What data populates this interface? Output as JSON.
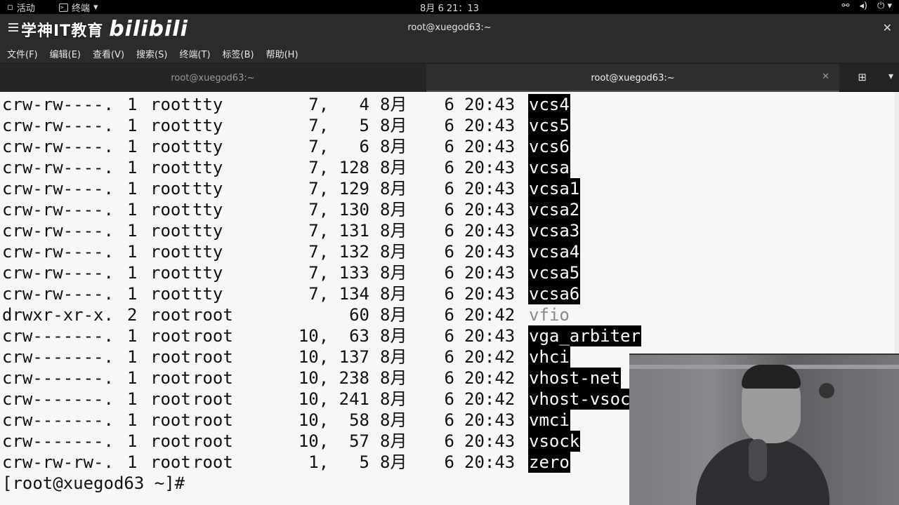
{
  "topbar": {
    "activities": "活动",
    "app_name": "终端",
    "clock": "8月 6  21：13",
    "tray_icons": [
      "network-icon",
      "volume-icon",
      "power-icon"
    ]
  },
  "window": {
    "title": "root@xuegod63:~",
    "logo_text": "学神IT教育",
    "logo_bili": "bilibili"
  },
  "menu": [
    "文件(F)",
    "编辑(E)",
    "查看(V)",
    "搜索(S)",
    "终端(T)",
    "标签(B)",
    "帮助(H)"
  ],
  "tabs": [
    {
      "label": "root@xuegod63:~",
      "active": false
    },
    {
      "label": "root@xuegod63:~",
      "active": true
    }
  ],
  "terminal": {
    "lines": [
      {
        "perm": "crw-rw----.",
        "links": "1",
        "owner": "root",
        "group": "tty",
        "size": "7,   4",
        "month": "8月",
        "day": "6",
        "time": "20:43",
        "name": "vcs4",
        "type": "dev"
      },
      {
        "perm": "crw-rw----.",
        "links": "1",
        "owner": "root",
        "group": "tty",
        "size": "7,   5",
        "month": "8月",
        "day": "6",
        "time": "20:43",
        "name": "vcs5",
        "type": "dev"
      },
      {
        "perm": "crw-rw----.",
        "links": "1",
        "owner": "root",
        "group": "tty",
        "size": "7,   6",
        "month": "8月",
        "day": "6",
        "time": "20:43",
        "name": "vcs6",
        "type": "dev"
      },
      {
        "perm": "crw-rw----.",
        "links": "1",
        "owner": "root",
        "group": "tty",
        "size": "7, 128",
        "month": "8月",
        "day": "6",
        "time": "20:43",
        "name": "vcsa",
        "type": "dev"
      },
      {
        "perm": "crw-rw----.",
        "links": "1",
        "owner": "root",
        "group": "tty",
        "size": "7, 129",
        "month": "8月",
        "day": "6",
        "time": "20:43",
        "name": "vcsa1",
        "type": "dev"
      },
      {
        "perm": "crw-rw----.",
        "links": "1",
        "owner": "root",
        "group": "tty",
        "size": "7, 130",
        "month": "8月",
        "day": "6",
        "time": "20:43",
        "name": "vcsa2",
        "type": "dev"
      },
      {
        "perm": "crw-rw----.",
        "links": "1",
        "owner": "root",
        "group": "tty",
        "size": "7, 131",
        "month": "8月",
        "day": "6",
        "time": "20:43",
        "name": "vcsa3",
        "type": "dev"
      },
      {
        "perm": "crw-rw----.",
        "links": "1",
        "owner": "root",
        "group": "tty",
        "size": "7, 132",
        "month": "8月",
        "day": "6",
        "time": "20:43",
        "name": "vcsa4",
        "type": "dev"
      },
      {
        "perm": "crw-rw----.",
        "links": "1",
        "owner": "root",
        "group": "tty",
        "size": "7, 133",
        "month": "8月",
        "day": "6",
        "time": "20:43",
        "name": "vcsa5",
        "type": "dev"
      },
      {
        "perm": "crw-rw----.",
        "links": "1",
        "owner": "root",
        "group": "tty",
        "size": "7, 134",
        "month": "8月",
        "day": "6",
        "time": "20:43",
        "name": "vcsa6",
        "type": "dev"
      },
      {
        "perm": "drwxr-xr-x.",
        "links": "2",
        "owner": "root",
        "group": "root",
        "size": "60",
        "month": "8月",
        "day": "6",
        "time": "20:42",
        "name": "vfio",
        "type": "dir"
      },
      {
        "perm": "crw-------.",
        "links": "1",
        "owner": "root",
        "group": "root",
        "size": "10,  63",
        "month": "8月",
        "day": "6",
        "time": "20:43",
        "name": "vga_arbiter",
        "type": "dev"
      },
      {
        "perm": "crw-------.",
        "links": "1",
        "owner": "root",
        "group": "root",
        "size": "10, 137",
        "month": "8月",
        "day": "6",
        "time": "20:42",
        "name": "vhci",
        "type": "dev"
      },
      {
        "perm": "crw-------.",
        "links": "1",
        "owner": "root",
        "group": "root",
        "size": "10, 238",
        "month": "8月",
        "day": "6",
        "time": "20:42",
        "name": "vhost-net",
        "type": "dev"
      },
      {
        "perm": "crw-------.",
        "links": "1",
        "owner": "root",
        "group": "root",
        "size": "10, 241",
        "month": "8月",
        "day": "6",
        "time": "20:42",
        "name": "vhost-vsoc",
        "type": "dev"
      },
      {
        "perm": "crw-------.",
        "links": "1",
        "owner": "root",
        "group": "root",
        "size": "10,  58",
        "month": "8月",
        "day": "6",
        "time": "20:43",
        "name": "vmci",
        "type": "dev"
      },
      {
        "perm": "crw-------.",
        "links": "1",
        "owner": "root",
        "group": "root",
        "size": "10,  57",
        "month": "8月",
        "day": "6",
        "time": "20:43",
        "name": "vsock",
        "type": "dev"
      },
      {
        "perm": "crw-rw-rw-.",
        "links": "1",
        "owner": "root",
        "group": "root",
        "size": "1,   5",
        "month": "8月",
        "day": "6",
        "time": "20:43",
        "name": "zero",
        "type": "dev"
      }
    ],
    "prompt": "[root@xuegod63 ~]#"
  }
}
